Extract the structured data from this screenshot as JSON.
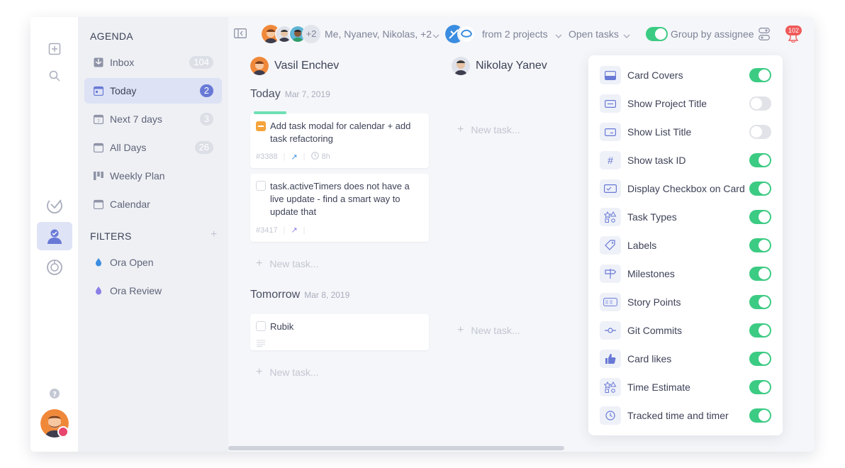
{
  "sidebar": {
    "agenda_heading": "AGENDA",
    "items": [
      {
        "label": "Inbox",
        "count": "104",
        "icon": "inbox-icon"
      },
      {
        "label": "Today",
        "count": "2",
        "icon": "calendar-today-icon"
      },
      {
        "label": "Next 7 days",
        "count": "3",
        "icon": "calendar-7-icon"
      },
      {
        "label": "All Days",
        "count": "26",
        "icon": "calendar-icon"
      },
      {
        "label": "Weekly Plan",
        "count": "",
        "icon": "weekly-plan-icon"
      },
      {
        "label": "Calendar",
        "count": "",
        "icon": "calendar-icon"
      }
    ],
    "filters_heading": "FILTERS",
    "filters": [
      {
        "label": "Ora Open",
        "color": "#3a8de0"
      },
      {
        "label": "Ora Review",
        "color": "#8a7fe6"
      }
    ]
  },
  "topbar": {
    "avatars_more": "+2",
    "assignees": "Me, Nyanev, Nikolas, +2",
    "projects": "from 2 projects",
    "status": "Open tasks",
    "group_label": "Group by assignee",
    "notifications": "102"
  },
  "columns": [
    {
      "assignee": "Vasil Enchev",
      "today_title": "Today",
      "today_date": "Mar 7, 2019",
      "tomorrow_title": "Tomorrow",
      "tomorrow_date": "Mar 8, 2019",
      "cards": [
        {
          "title": "Add task modal for calendar + add task refactoring",
          "id": "#3388",
          "time": "8h"
        },
        {
          "title": "task.activeTimers does not have a live update - find a smart way to update that",
          "id": "#3417"
        },
        {
          "title": "Rubik"
        }
      ],
      "new_task": "New task..."
    },
    {
      "assignee": "Nikolay Yanev",
      "new_task": "New task..."
    }
  ],
  "settings": [
    {
      "label": "Card Covers",
      "on": true,
      "icon": "card-cover-icon"
    },
    {
      "label": "Show Project Title",
      "on": false,
      "icon": "project-title-icon"
    },
    {
      "label": "Show List Title",
      "on": false,
      "icon": "list-title-icon"
    },
    {
      "label": "Show task ID",
      "on": true,
      "icon": "hash-icon"
    },
    {
      "label": "Display Checkbox on Card",
      "on": true,
      "icon": "checkbox-icon"
    },
    {
      "label": "Task Types",
      "on": true,
      "icon": "task-types-icon"
    },
    {
      "label": "Labels",
      "on": true,
      "icon": "tag-icon"
    },
    {
      "label": "Milestones",
      "on": true,
      "icon": "signpost-icon"
    },
    {
      "label": "Story Points",
      "on": true,
      "icon": "story-points-icon"
    },
    {
      "label": "Git Commits",
      "on": true,
      "icon": "git-commit-icon"
    },
    {
      "label": "Card likes",
      "on": true,
      "icon": "thumbs-up-icon"
    },
    {
      "label": "Time Estimate",
      "on": true,
      "icon": "time-estimate-icon"
    },
    {
      "label": "Tracked time and timer",
      "on": true,
      "icon": "clock-icon"
    }
  ],
  "colors": {
    "accent": "#6979d6",
    "toggle_on": "#3ccb83",
    "toggle_off": "#e1e3e8",
    "notification": "#f05a5a"
  }
}
